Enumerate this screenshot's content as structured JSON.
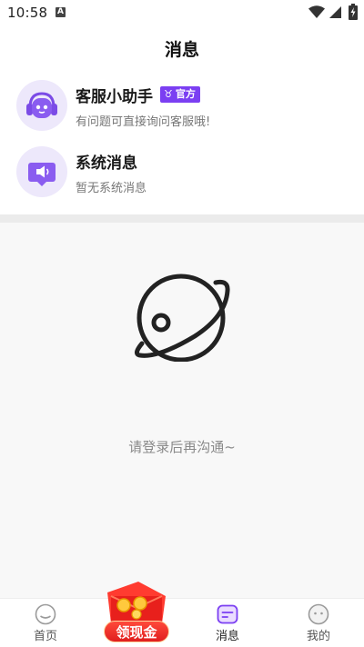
{
  "status_bar": {
    "time": "10:58",
    "notification_glyph": "A"
  },
  "header": {
    "title": "消息"
  },
  "messages": [
    {
      "title": "客服小助手",
      "badge": "官方",
      "badge_icon": "♉",
      "preview": "有问题可直接询问客服哦!",
      "icon": "robot-headset-icon"
    },
    {
      "title": "系统消息",
      "preview": "暂无系统消息",
      "icon": "speaker-message-icon"
    }
  ],
  "empty_state": {
    "text": "请登录后再沟通~",
    "icon": "planet-icon"
  },
  "bottom_nav": {
    "items": [
      {
        "label": "首页",
        "icon": "home-icon"
      },
      {
        "label": "领现金",
        "icon": "red-envelope-icon"
      },
      {
        "label": "消息",
        "icon": "message-icon"
      },
      {
        "label": "我的",
        "icon": "profile-icon"
      }
    ],
    "active": "消息"
  },
  "colors": {
    "accent": "#7b3ff2",
    "promo_red": "#e01e1e",
    "background": "#f8f8f8"
  }
}
